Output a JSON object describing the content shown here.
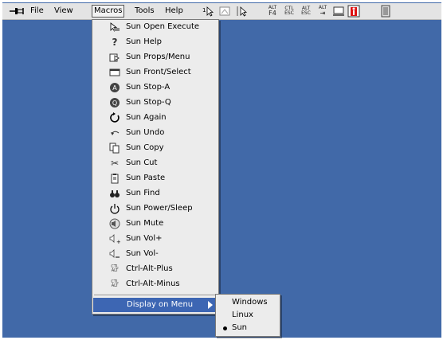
{
  "menubar": {
    "items": [
      "File",
      "View",
      "Macros",
      "Tools",
      "Help"
    ]
  },
  "toolbar": {
    "alt_f4": [
      "ALT",
      "F4"
    ],
    "ctl_esc": [
      "CTL",
      "ESC"
    ],
    "alt_esc": [
      "ALT",
      "ESC"
    ],
    "alt_tab": [
      "ALT",
      "⇥"
    ]
  },
  "macros_menu": {
    "items": [
      {
        "label": "Sun Open Execute",
        "icon": "open-execute-icon"
      },
      {
        "label": "Sun Help",
        "icon": "help-icon"
      },
      {
        "label": "Sun Props/Menu",
        "icon": "props-menu-icon"
      },
      {
        "label": "Sun Front/Select",
        "icon": "front-select-icon"
      },
      {
        "label": "Sun Stop-A",
        "icon": "stop-a-icon"
      },
      {
        "label": "Sun Stop-Q",
        "icon": "stop-q-icon"
      },
      {
        "label": "Sun Again",
        "icon": "again-icon"
      },
      {
        "label": "Sun Undo",
        "icon": "undo-icon"
      },
      {
        "label": "Sun Copy",
        "icon": "copy-icon"
      },
      {
        "label": "Sun Cut",
        "icon": "cut-icon"
      },
      {
        "label": "Sun Paste",
        "icon": "paste-icon"
      },
      {
        "label": "Sun Find",
        "icon": "find-icon"
      },
      {
        "label": "Sun Power/Sleep",
        "icon": "power-icon"
      },
      {
        "label": "Sun Mute",
        "icon": "mute-icon"
      },
      {
        "label": "Sun Vol+",
        "icon": "volume-up-icon"
      },
      {
        "label": "Sun Vol-",
        "icon": "volume-down-icon"
      },
      {
        "label": "Ctrl-Alt-Plus",
        "icon": "ctrl-alt-icon"
      },
      {
        "label": "Ctrl-Alt-Minus",
        "icon": "ctrl-alt-icon"
      }
    ],
    "display_on_menu": "Display on Menu",
    "ctl_alt": [
      "CTL",
      "ALT"
    ]
  },
  "submenu": {
    "items": [
      "Windows",
      "Linux",
      "Sun"
    ],
    "selected": "Sun"
  },
  "colors": {
    "desktop": "#4169a8",
    "menu_bg": "#ececec",
    "highlight": "#3d66b3"
  }
}
